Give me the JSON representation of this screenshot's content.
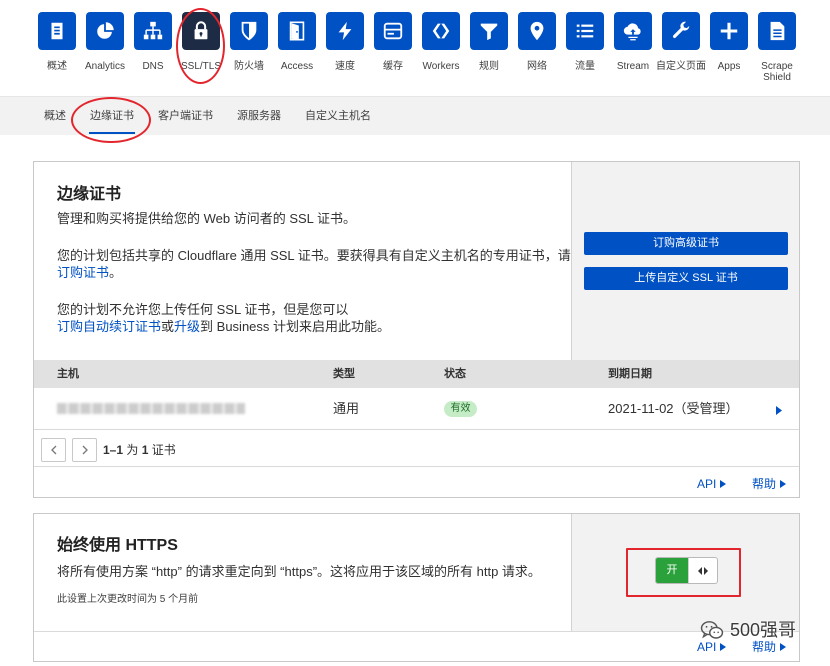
{
  "nav": {
    "items": [
      {
        "label": "概述",
        "icon": "document-icon"
      },
      {
        "label": "Analytics",
        "icon": "pie-chart-icon"
      },
      {
        "label": "DNS",
        "icon": "network-icon"
      },
      {
        "label": "SSL/TLS",
        "icon": "lock-icon",
        "active": true
      },
      {
        "label": "防火墙",
        "icon": "shield-icon"
      },
      {
        "label": "Access",
        "icon": "door-icon"
      },
      {
        "label": "速度",
        "icon": "bolt-icon"
      },
      {
        "label": "缓存",
        "icon": "drive-icon"
      },
      {
        "label": "Workers",
        "icon": "workers-icon"
      },
      {
        "label": "规则",
        "icon": "filter-icon"
      },
      {
        "label": "网络",
        "icon": "location-pin-icon"
      },
      {
        "label": "流量",
        "icon": "list-icon"
      },
      {
        "label": "Stream",
        "icon": "cloud-upload-icon"
      },
      {
        "label": "自定义页面",
        "icon": "wrench-icon"
      },
      {
        "label": "Apps",
        "icon": "plus-icon"
      },
      {
        "label": "Scrape Shield",
        "icon": "document-icon"
      }
    ]
  },
  "subnav": {
    "tabs": [
      {
        "label": "概述"
      },
      {
        "label": "边缘证书",
        "active": true
      },
      {
        "label": "客户端证书"
      },
      {
        "label": "源服务器"
      },
      {
        "label": "自定义主机名"
      }
    ]
  },
  "edge_certificates": {
    "title": "边缘证书",
    "description": "管理和购买将提供给您的 Web 访问者的 SSL 证书。",
    "plan_line1": "您的计划包括共享的 Cloudflare 通用 SSL 证书。要获得具有自定义主机名的专用证书，请",
    "order_certificate_link": "订购证书",
    "plan_line2_end": "。",
    "upload_line1": "您的计划不允许您上传任何 SSL 证书，但是您可以",
    "auto_renew_link": "订购自动续订证书",
    "or_text": "或",
    "upgrade_link": "升级",
    "upgrade_suffix": "到 Business 计划来启用此功能。",
    "actions": {
      "order_advanced": "订购高级证书",
      "upload_custom": "上传自定义 SSL 证书"
    },
    "table": {
      "headers": [
        "主机",
        "类型",
        "状态",
        "到期日期"
      ],
      "rows": [
        {
          "type": "通用",
          "status": "有效",
          "expiry": "2021-11-02（受管理）"
        }
      ]
    },
    "pagination": {
      "range": "1–1",
      "of_text": "为",
      "total": "1",
      "unit": "证书"
    },
    "footer": {
      "api": "API",
      "help": "帮助"
    }
  },
  "always_https": {
    "title": "始终使用 HTTPS",
    "description": "将所有使用方案 “http” 的请求重定向到 “https”。这将应用于该区域的所有 http 请求。",
    "last_changed": "此设置上次更改时间为 5 个月前",
    "toggle": {
      "on_label": "开",
      "state": "on"
    },
    "footer": {
      "api": "API",
      "help": "帮助"
    }
  },
  "watermark": {
    "text": "500强哥",
    "icon": "wechat-icon"
  },
  "colors": {
    "brand_blue": "#0051c3",
    "active_nav": "#1d2b44",
    "toggle_on": "#2ba13b",
    "status_badge_bg": "#c6ebc7",
    "annotation_red": "#e3262d"
  }
}
